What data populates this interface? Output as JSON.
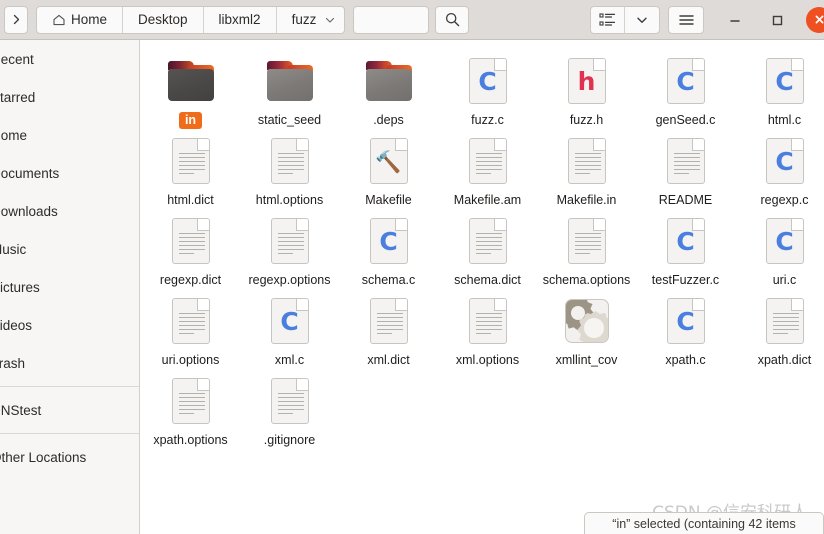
{
  "window": {
    "app": "Files",
    "controls": {
      "back_icon": "chevron-right-icon",
      "minimize_label": "–",
      "maximize_label": "□",
      "close_label": "✕"
    }
  },
  "pathbar": {
    "home_icon": "home-icon",
    "crumbs": [
      {
        "label": "Home",
        "icon": "home-icon"
      },
      {
        "label": "Desktop",
        "icon": ""
      },
      {
        "label": "libxml2",
        "icon": ""
      },
      {
        "label": "fuzz",
        "icon": "chevron-down-icon"
      }
    ]
  },
  "toolbar": {
    "location_value": "",
    "location_placeholder": "",
    "search_icon": "search-icon",
    "list_view_icon": "list-view-icon",
    "view_dropdown_icon": "chevron-down-icon",
    "menu_icon": "hamburger-menu-icon"
  },
  "sidebar": {
    "items": [
      {
        "label": "Recent"
      },
      {
        "label": "Starred"
      },
      {
        "label": "Home"
      },
      {
        "label": "Documents"
      },
      {
        "label": "Downloads"
      },
      {
        "label": "Music"
      },
      {
        "label": "Pictures"
      },
      {
        "label": "Videos"
      },
      {
        "label": "Trash"
      }
    ],
    "devices": [
      {
        "label": "DNStest"
      }
    ],
    "network": [
      {
        "label": "Other Locations"
      }
    ]
  },
  "files": [
    {
      "name": "in",
      "type": "folder-dark",
      "selected": true
    },
    {
      "name": "static_seed",
      "type": "folder",
      "selected": false
    },
    {
      "name": ".deps",
      "type": "folder",
      "selected": false
    },
    {
      "name": "fuzz.c",
      "type": "c-source",
      "selected": false
    },
    {
      "name": "fuzz.h",
      "type": "h-header",
      "selected": false
    },
    {
      "name": "genSeed.c",
      "type": "c-source",
      "selected": false
    },
    {
      "name": "html.c",
      "type": "c-source",
      "selected": false
    },
    {
      "name": "html.dict",
      "type": "text",
      "selected": false
    },
    {
      "name": "html.options",
      "type": "text",
      "selected": false
    },
    {
      "name": "Makefile",
      "type": "makefile",
      "selected": false
    },
    {
      "name": "Makefile.am",
      "type": "text",
      "selected": false
    },
    {
      "name": "Makefile.in",
      "type": "text",
      "selected": false
    },
    {
      "name": "README",
      "type": "text",
      "selected": false
    },
    {
      "name": "regexp.c",
      "type": "c-source",
      "selected": false
    },
    {
      "name": "regexp.dict",
      "type": "text",
      "selected": false
    },
    {
      "name": "regexp.options",
      "type": "text",
      "selected": false
    },
    {
      "name": "schema.c",
      "type": "c-source",
      "selected": false
    },
    {
      "name": "schema.dict",
      "type": "text",
      "selected": false
    },
    {
      "name": "schema.options",
      "type": "text",
      "selected": false
    },
    {
      "name": "testFuzzer.c",
      "type": "c-source",
      "selected": false
    },
    {
      "name": "uri.c",
      "type": "c-source",
      "selected": false
    },
    {
      "name": "uri.options",
      "type": "text",
      "selected": false
    },
    {
      "name": "xml.c",
      "type": "c-source",
      "selected": false
    },
    {
      "name": "xml.dict",
      "type": "text",
      "selected": false
    },
    {
      "name": "xml.options",
      "type": "text",
      "selected": false
    },
    {
      "name": "xmllint_cov",
      "type": "executable",
      "selected": false
    },
    {
      "name": "xpath.c",
      "type": "c-source",
      "selected": false
    },
    {
      "name": "xpath.dict",
      "type": "text",
      "selected": false
    },
    {
      "name": "xpath.options",
      "type": "text",
      "selected": false
    },
    {
      "name": ".gitignore",
      "type": "text",
      "selected": false
    }
  ],
  "status": {
    "text": "“in” selected (containing 42 items"
  },
  "watermark": {
    "text": "CSDN @信安科研人"
  },
  "colors": {
    "accent": "#ef5022",
    "selection": "#ef6c1b",
    "headerbar": "#dedbd8",
    "sidebar": "#f7f6f5",
    "c_glyph": "#4a7fe0",
    "h_glyph": "#e0314f"
  }
}
